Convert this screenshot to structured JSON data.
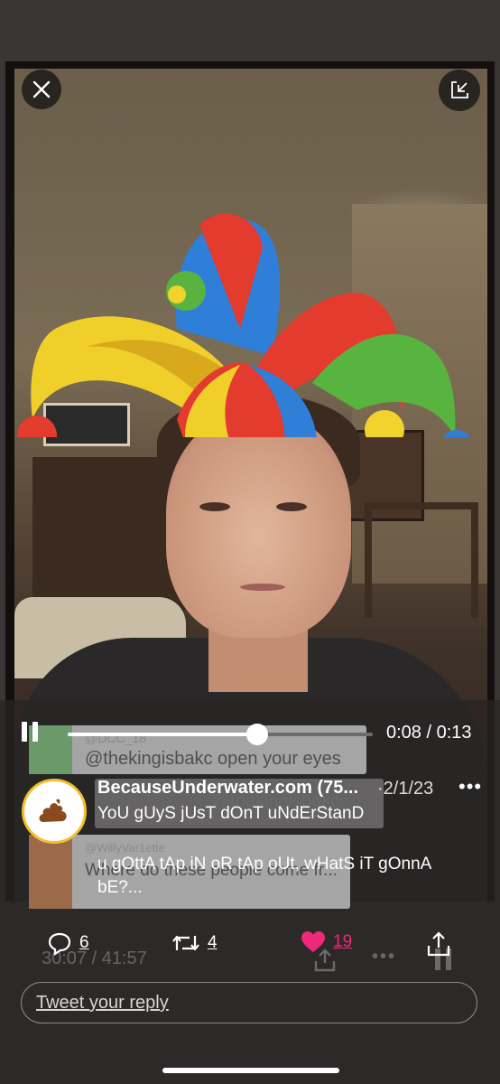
{
  "player": {
    "elapsed": "0:08",
    "duration": "0:13",
    "progress_fraction": 0.62
  },
  "tweet": {
    "author": "BecauseUnderwater.com (75...",
    "separator": "·",
    "date": "2/1/23",
    "more": "•••",
    "text_line1": "YoU gUyS jUsT dOnT uNdErStanD",
    "text_line2": "u gOttA tAp iN oR tAp oUt, wHatS iT gOnnA bE?..."
  },
  "actions": {
    "replies": "6",
    "retweets": "4",
    "likes": "19"
  },
  "reply_placeholder": "Tweet your reply",
  "background_ui": {
    "comment1_user": "@DCC_18",
    "comment1_text": "@thekingisbakc open your eyes",
    "comment2_text": "@thekingisbakc",
    "comment3_user": "@WillyVar1ette",
    "comment3_text": "Where do these people come fr...",
    "space_time": "30:07 / 41:57"
  },
  "colors": {
    "like_pink": "#f0287a",
    "avatar_ring": "#f2c02c"
  }
}
